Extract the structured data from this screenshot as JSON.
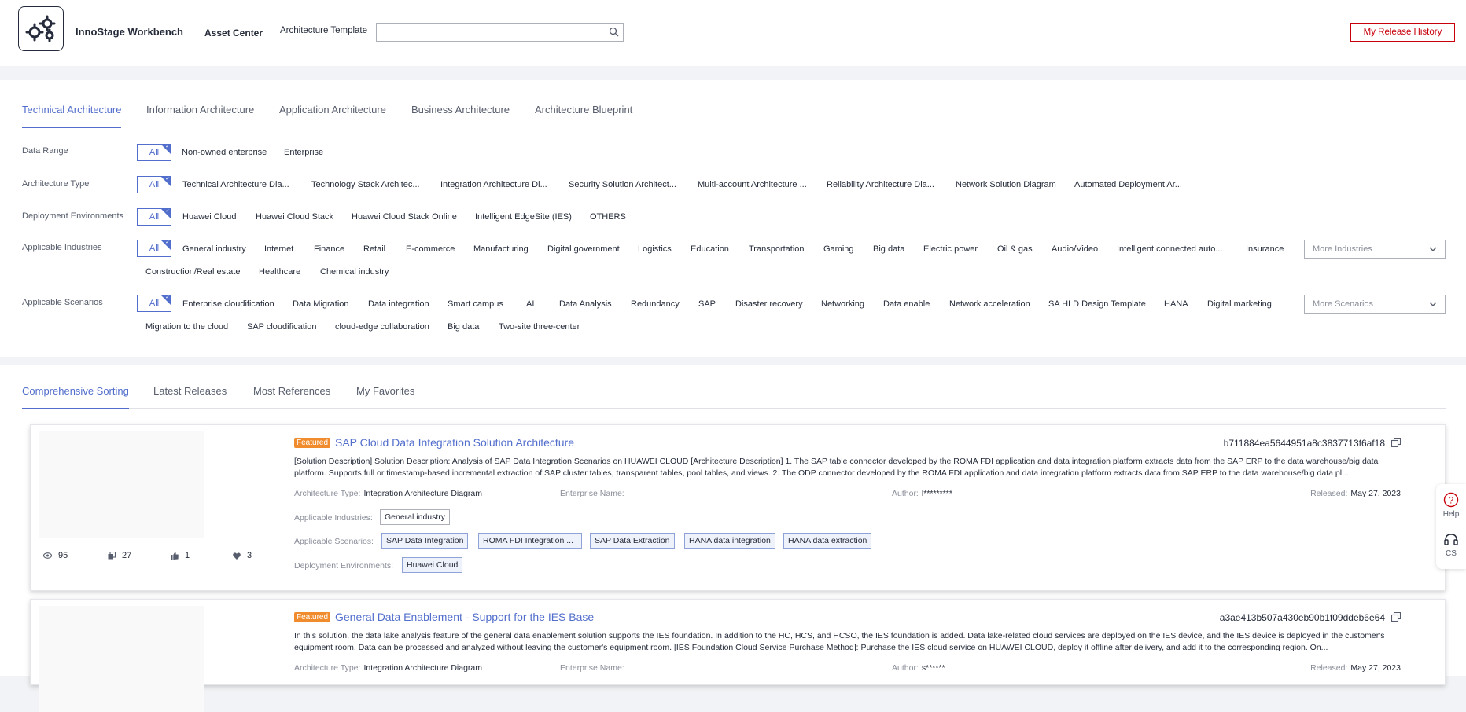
{
  "header": {
    "app_name": "InnoStage Workbench",
    "nav_asset_center": "Asset Center",
    "nav_architecture_template": "Architecture Template",
    "search_value": "",
    "release_history_label": "My Release History",
    "logo_icon": "gears-logo-icon"
  },
  "arch_tabs": [
    "Technical Architecture",
    "Information Architecture",
    "Application Architecture",
    "Business Architecture",
    "Architecture Blueprint"
  ],
  "filters": {
    "all_label": "All",
    "data_range": {
      "label": "Data Range",
      "options": [
        "Non-owned enterprise",
        "Enterprise"
      ]
    },
    "architecture_type": {
      "label": "Architecture Type",
      "options": [
        "Technical Architecture Dia...",
        "Technology Stack Architec...",
        "Integration Architecture Di...",
        "Security Solution Architect...",
        "Multi-account Architecture ...",
        "Reliability Architecture Dia...",
        "Network Solution Diagram",
        "Automated Deployment Ar..."
      ]
    },
    "deployment_environments": {
      "label": "Deployment Environments",
      "options": [
        "Huawei Cloud",
        "Huawei Cloud Stack",
        "Huawei Cloud Stack Online",
        "Intelligent EdgeSite (IES)",
        "OTHERS"
      ]
    },
    "applicable_industries": {
      "label": "Applicable Industries",
      "options": [
        "General industry",
        "Internet",
        "Finance",
        "Retail",
        "E-commerce",
        "Manufacturing",
        "Digital government",
        "Logistics",
        "Education",
        "Transportation",
        "Gaming",
        "Big data",
        "Electric power",
        "Oil & gas",
        "Audio/Video",
        "Intelligent connected auto...",
        "Insurance"
      ],
      "options_row2": [
        "Construction/Real estate",
        "Healthcare",
        "Chemical industry"
      ],
      "more_placeholder": "More Industries"
    },
    "applicable_scenarios": {
      "label": "Applicable Scenarios",
      "options": [
        "Enterprise cloudification",
        "Data Migration",
        "Data integration",
        "Smart campus",
        "AI",
        "Data Analysis",
        "Redundancy",
        "SAP",
        "Disaster recovery",
        "Networking",
        "Data enable",
        "Network acceleration",
        "SA HLD Design Template",
        "HANA",
        "Digital marketing"
      ],
      "options_row2": [
        "Migration to the cloud",
        "SAP cloudification",
        "cloud-edge collaboration",
        "Big data",
        "Two-site three-center"
      ],
      "more_placeholder": "More Scenarios"
    }
  },
  "sort_tabs": [
    "Comprehensive Sorting",
    "Latest Releases",
    "Most References",
    "My Favorites"
  ],
  "meta_labels": {
    "architecture_type": "Architecture Type:",
    "enterprise_name": "Enterprise Name:",
    "author": "Author:",
    "released": "Released:",
    "applicable_industries": "Applicable Industries:",
    "applicable_scenarios": "Applicable Scenarios:",
    "deployment_environments": "Deployment Environments:"
  },
  "cards": [
    {
      "badge": "Featured",
      "title": "SAP Cloud Data Integration Solution Architecture",
      "id": "b711884ea5644951a8c3837713f6af18",
      "description": "[Solution Description] Solution Description: Analysis of SAP Data Integration Scenarios on HUAWEI CLOUD [Architecture Description] 1. The SAP table connector developed by the ROMA FDI application and data integration platform extracts data from the SAP ERP to the data warehouse/big data platform. Supports full or timestamp-based incremental extraction of SAP cluster tables, transparent tables, pool tables, and views. 2. The ODP connector developed by the ROMA FDI application and data integration platform extracts data from SAP ERP to the data warehouse/big data pl...",
      "architecture_type": "Integration Architecture Diagram",
      "enterprise_name": "",
      "author": "l*********",
      "released": "May 27, 2023",
      "industries": [
        "General industry"
      ],
      "scenarios": [
        "SAP Data Integration",
        "ROMA FDI Integration ...",
        "SAP Data Extraction",
        "HANA data integration",
        "HANA data extraction"
      ],
      "deployment": [
        "Huawei Cloud"
      ],
      "stats": {
        "views": "95",
        "references": "27",
        "likes": "1",
        "favorites": "3"
      }
    },
    {
      "badge": "Featured",
      "title": "General Data Enablement - Support for the IES Base",
      "id": "a3ae413b507a430eb90b1f09ddeb6e64",
      "description": "In this solution, the data lake analysis feature of the general data enablement solution supports the IES foundation. In addition to the HC, HCS, and HCSO, the IES foundation is added. Data lake-related cloud services are deployed on the IES device, and the IES device is deployed in the customer's equipment room. Data can be processed and analyzed without leaving the customer's equipment room. [IES Foundation Cloud Service Purchase Method]: Purchase the IES cloud service on HUAWEI CLOUD, deploy it offline after delivery, and add it to the corresponding region. On...",
      "architecture_type": "Integration Architecture Diagram",
      "enterprise_name": "",
      "author": "s******",
      "released": "May 27, 2023"
    }
  ],
  "side_tools": {
    "help": "Help",
    "cs": "CS"
  },
  "colors": {
    "accent": "#526ecc",
    "brand_red": "#c7000b",
    "featured": "#f08c2e"
  }
}
